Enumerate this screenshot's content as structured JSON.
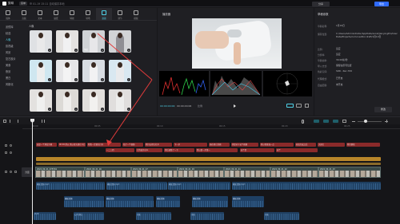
{
  "titlebar": {
    "app_name": "剪映",
    "menu_label": "菜单",
    "autosave": "01-19 15:11 自动保存本地",
    "share_label": "分享",
    "export_label": "导出"
  },
  "toolbar": {
    "items": [
      {
        "label": "媒体",
        "icon": "media-icon"
      },
      {
        "label": "音频",
        "icon": "audio-icon"
      },
      {
        "label": "文本",
        "icon": "text-icon"
      },
      {
        "label": "贴纸",
        "icon": "sticker-icon"
      },
      {
        "label": "特效",
        "icon": "effects-icon"
      },
      {
        "label": "转场",
        "icon": "transition-icon"
      },
      {
        "label": "滤镜",
        "icon": "filter-icon"
      },
      {
        "label": "调节",
        "icon": "adjust-icon"
      },
      {
        "label": "模板",
        "icon": "template-icon"
      }
    ],
    "active_index": 6
  },
  "categories": {
    "items": [
      "滤镜库",
      "精选",
      "人像",
      "影视级",
      "风景",
      "复古胶片",
      "美食",
      "夜景",
      "黑白",
      "风格化"
    ],
    "active_index": 2
  },
  "filter_section_title": "人像",
  "filters": [
    {
      "name": "",
      "bg": "#dfe1e4",
      "fig": "#e9e9ea"
    },
    {
      "name": "",
      "bg": "#e4e2e0",
      "fig": "#f1f1f2"
    },
    {
      "name": "净透",
      "bg": "#cfd2d5",
      "fig": "#e7e7e9"
    },
    {
      "name": "",
      "bg": "#d2d4d6",
      "fig": "#8f8f94"
    },
    {
      "name": "",
      "bg": "#cfe7f0",
      "fig": "#eceeee"
    },
    {
      "name": "",
      "bg": "#e6e6e8",
      "fig": "#f3f3f4"
    },
    {
      "name": "",
      "bg": "#d8dde3",
      "fig": "#f2f2f3"
    },
    {
      "name": "",
      "bg": "#d9e8f1",
      "fig": "#e9eaec"
    },
    {
      "name": "",
      "bg": "#e3e1df",
      "fig": "#f0f0ef"
    },
    {
      "name": "",
      "bg": "#dcdad6",
      "fig": "#efeeec"
    },
    {
      "name": "",
      "bg": "#e2dfdc",
      "fig": "#f2f1ef"
    },
    {
      "name": "",
      "bg": "#e0dedd",
      "fig": "#ededec"
    }
  ],
  "player": {
    "title": "播放器",
    "timecode": "00:00:00:00",
    "duration": "00:00:29:06",
    "ratio_label": "比例"
  },
  "details": {
    "title": "草稿参数",
    "rows": [
      {
        "label": "草稿名称:",
        "value": "1月19日"
      },
      {
        "label": "保存位置:",
        "value": "C:/Users/Administrator/AppData/Local/JianyingPro/User Data/Projects/com.lveditor.draft/1月19日"
      },
      {
        "label": "比例:",
        "value": "适应"
      },
      {
        "label": "分辨率:",
        "value": "适应"
      },
      {
        "label": "草稿帧率:",
        "value": "30.00帧/秒"
      },
      {
        "label": "导入方式:",
        "value": "保留在原有位置"
      },
      {
        "label": "色彩空间:",
        "value": "SDR - Rec.709"
      },
      {
        "label": "代理模式:",
        "value": "已开启"
      },
      {
        "label": "自由层级:",
        "value": "未开启"
      }
    ],
    "modify_label": "修改"
  },
  "timeline": {
    "ruler_ticks": [
      "00:00",
      "00:05",
      "00:10",
      "00:15",
      "00:20",
      "00:25",
      "00:30"
    ],
    "cover_label": "封面",
    "text_track_a": [
      "这是一个测试字幕",
      "00 00 所以 所以首先要打开它",
      "我我一定要先打开",
      "拍了一个视频",
      "我们去把它打开",
      "下一步",
      "现在把它剪辑",
      "但是对于这个视频",
      "所以需要加一点",
      "修改完成之后",
      "关闭它",
      "我们继续"
    ],
    "text_track_b": [
      "一二三四",
      "它的拍的什么",
      "然后调整了一下",
      "所以第一步第一",
      "这个是",
      "这个"
    ],
    "video_labels": [
      "2022_09_21_075534",
      "2022_09_21_16",
      "2022_09_21_17",
      "2022_09_21_19",
      "2022_09_21_21",
      "2022_09_21_22",
      "2022_09_21_23"
    ],
    "audio_a": [
      "模板音频.mp3",
      "模板音频.mp3",
      "模板音频.mp3",
      "模板音频.mp3"
    ],
    "audio_b": [
      "模板音频",
      "模板音频",
      "模板音频",
      "模板音频",
      "模板音频"
    ],
    "audio_c": [
      "mp3",
      "口音音效",
      "音效",
      "音效",
      "音效"
    ]
  }
}
